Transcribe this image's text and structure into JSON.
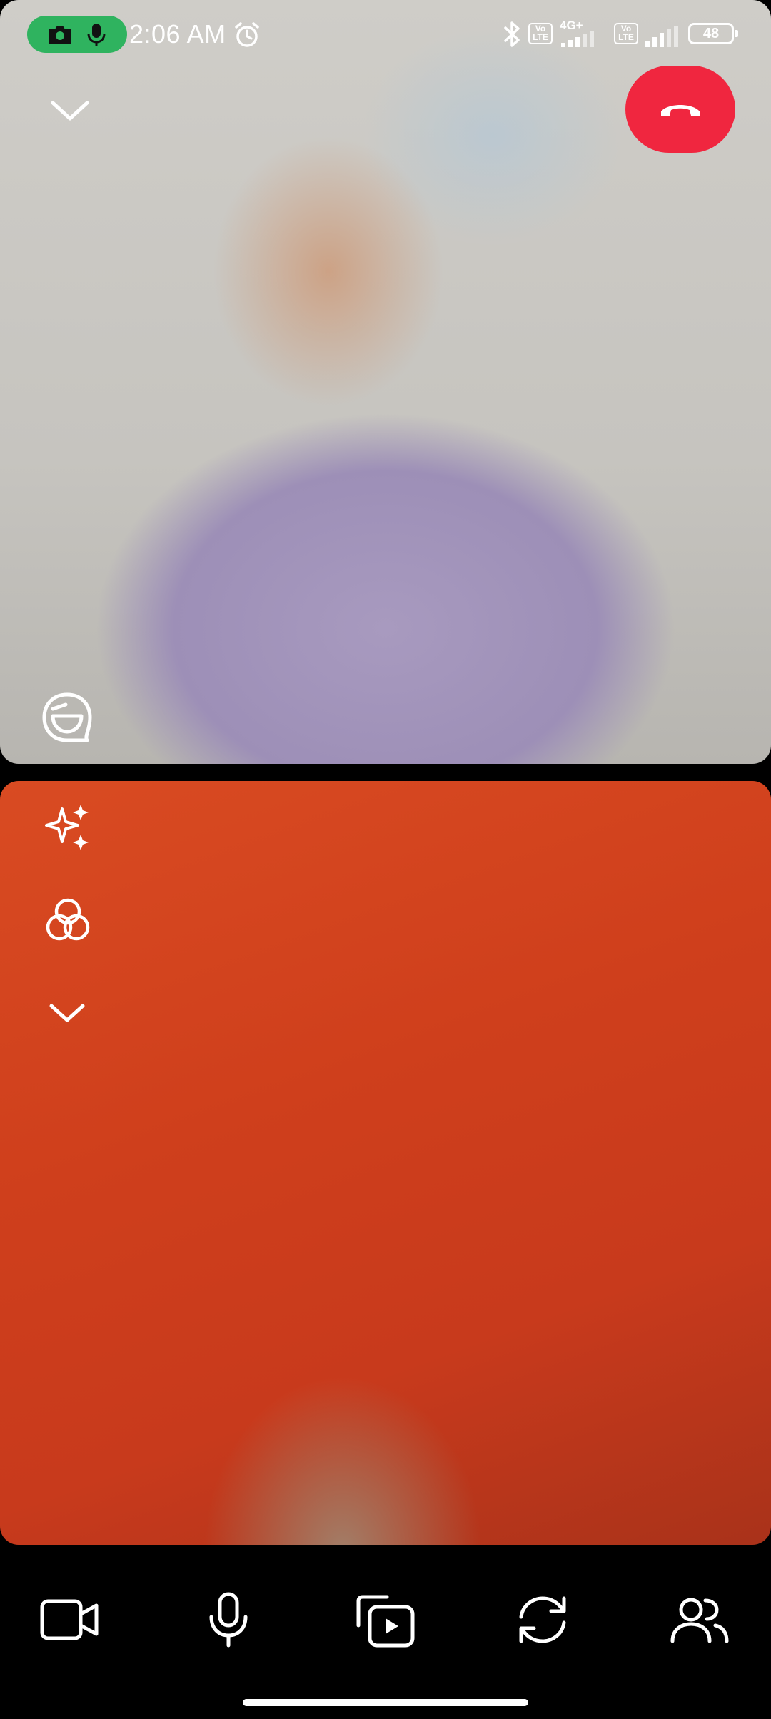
{
  "status_bar": {
    "time": "2:06 AM",
    "network_type": "4G+",
    "volte_1": "Vo LTE",
    "volte_2": "Vo LTE",
    "battery": "48"
  },
  "call": {
    "end_call_color": "#f0263f",
    "remote_video": {
      "icons": [
        "chevron-down-icon",
        "chat-sticker-icon"
      ]
    },
    "self_video": {
      "icons": [
        "sparkles-icon",
        "filter-lens-icon",
        "chevron-down-icon"
      ]
    }
  },
  "toolbar": {
    "buttons": [
      "video-camera-icon",
      "microphone-icon",
      "media-share-icon",
      "flip-camera-icon",
      "participants-icon"
    ]
  }
}
